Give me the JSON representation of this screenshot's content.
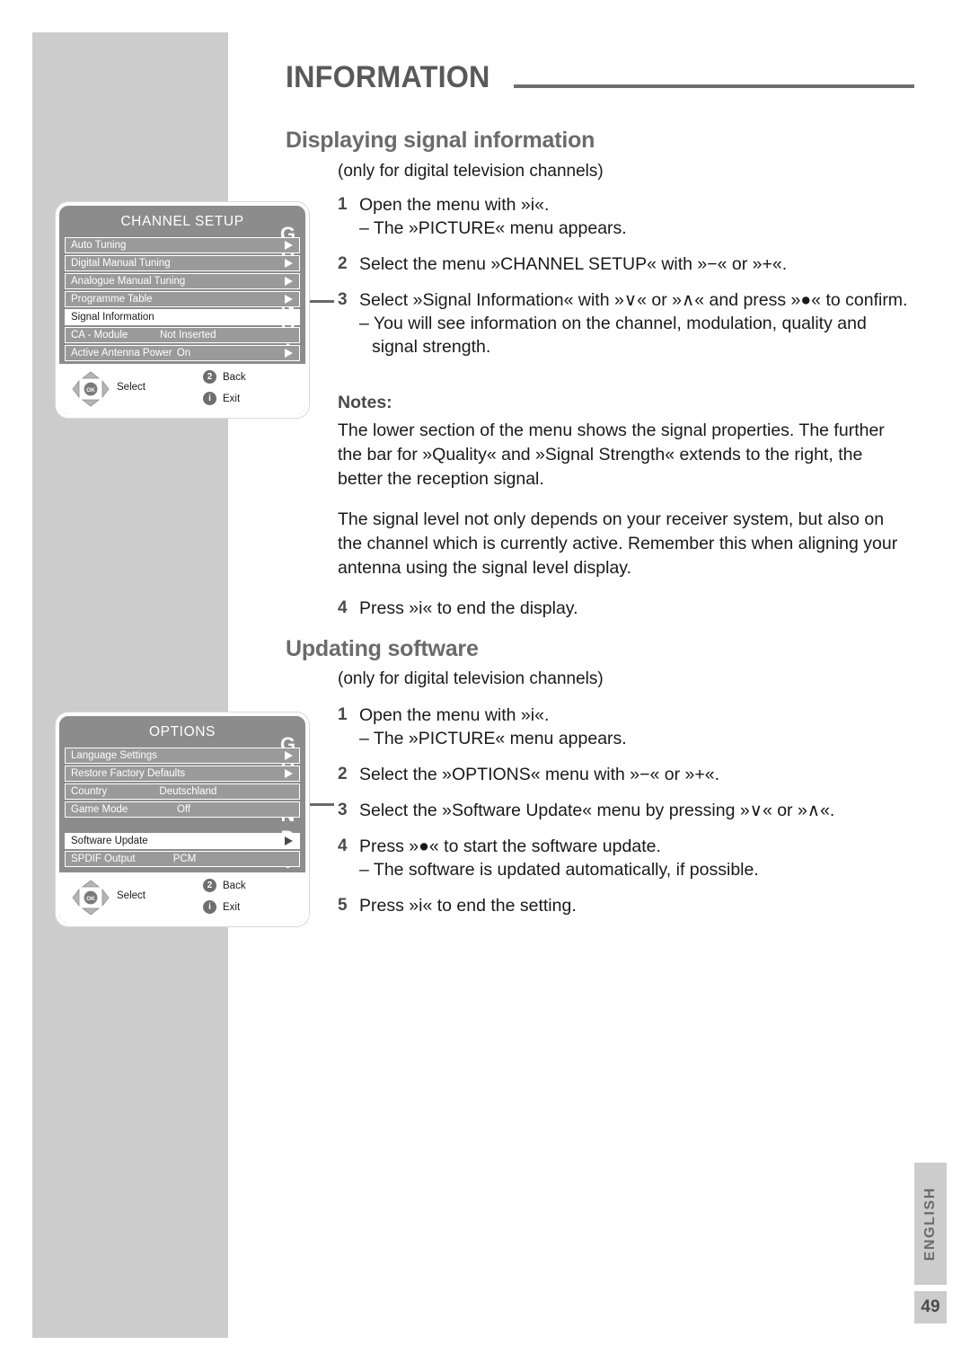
{
  "header": {
    "title": "INFORMATION"
  },
  "sections": [
    {
      "heading": "Displaying signal information",
      "subnote": "(only for digital television channels)"
    },
    {
      "heading": "Updating software",
      "subnote": "(only for digital television channels)"
    }
  ],
  "steps_signal": [
    {
      "num": "1",
      "text": "Open the menu with »i«.",
      "sub": "– The »PICTURE« menu appears."
    },
    {
      "num": "2",
      "text": "Select the menu »CHANNEL SETUP« with »−« or »+«.",
      "sub": ""
    },
    {
      "num": "3",
      "text": "Select »Signal Information« with »∨« or »∧« and press »●« to confirm.",
      "sub": "– You will see information on the channel, modulation, quality and signal strength."
    }
  ],
  "step_signal_last": {
    "num": "4",
    "text": "Press »i« to end the display."
  },
  "notes": {
    "title": "Notes:",
    "paragraphs": [
      "The lower section of the menu shows the signal properties. The further the bar for »Quality« and »Signal Strength« extends to the right, the better the reception signal.",
      "The signal level not only depends on your receiver system, but also on the channel which is currently active. Remember this when aligning your antenna using the signal level display."
    ]
  },
  "steps_software": [
    {
      "num": "1",
      "text": "Open the menu with »i«.",
      "sub": "– The »PICTURE« menu appears."
    },
    {
      "num": "2",
      "text": "Select the »OPTIONS« menu with »−« or »+«.",
      "sub": ""
    },
    {
      "num": "3",
      "text": "Select the »Software Update« menu by pressing »∨« or »∧«.",
      "sub": ""
    },
    {
      "num": "4",
      "text": "Press »●« to start the software update.",
      "sub": "– The software is updated automatically, if possible."
    },
    {
      "num": "5",
      "text": "Press »i« to end the setting.",
      "sub": ""
    }
  ],
  "osd_channel_setup": {
    "title": "CHANNEL SETUP",
    "brand": "GRUNDIG",
    "rows": [
      {
        "label": "Auto Tuning",
        "value": "",
        "arrow": true,
        "selected": false,
        "spacer": false
      },
      {
        "label": "Digital Manual Tuning",
        "value": "",
        "arrow": true,
        "selected": false,
        "spacer": false
      },
      {
        "label": "Analogue Manual Tuning",
        "value": "",
        "arrow": true,
        "selected": false,
        "spacer": false
      },
      {
        "label": "Programme Table",
        "value": "",
        "arrow": true,
        "selected": false,
        "spacer": false
      },
      {
        "label": "Signal Information",
        "value": "",
        "arrow": false,
        "selected": true,
        "spacer": false
      },
      {
        "label": "CA - Module",
        "value": "Not Inserted",
        "arrow": false,
        "selected": false,
        "spacer": false
      },
      {
        "label": "Active Antenna Power",
        "value": "On",
        "arrow": true,
        "selected": false,
        "spacer": false
      }
    ],
    "footer": {
      "select": "Select",
      "back_badge": "2",
      "back_label": "Back",
      "exit_badge": "i",
      "exit_label": "Exit"
    }
  },
  "osd_options": {
    "title": "OPTIONS",
    "brand": "GRUNDIG",
    "rows": [
      {
        "label": "Language Settings",
        "value": "",
        "arrow": true,
        "selected": false,
        "spacer": false
      },
      {
        "label": "Restore Factory Defaults",
        "value": "",
        "arrow": true,
        "selected": false,
        "spacer": false
      },
      {
        "label": "Country",
        "value": "Deutschland",
        "arrow": false,
        "selected": false,
        "spacer": false
      },
      {
        "label": "Game Mode",
        "value": "Off",
        "arrow": false,
        "selected": false,
        "spacer": false
      },
      {
        "label": "",
        "value": "",
        "arrow": false,
        "selected": false,
        "spacer": true
      },
      {
        "label": "Software Update",
        "value": "",
        "arrow": true,
        "selected": true,
        "spacer": false
      },
      {
        "label": "SPDIF Output",
        "value": "PCM",
        "arrow": false,
        "selected": false,
        "spacer": false
      }
    ],
    "footer": {
      "select": "Select",
      "back_badge": "2",
      "back_label": "Back",
      "exit_badge": "i",
      "exit_label": "Exit"
    }
  },
  "side_tabs": {
    "language": "ENGLISH",
    "page_number": "49"
  },
  "colors": {
    "grey_band": "#cccccc",
    "heading_grey": "#6b6b6b",
    "rule_grey": "#6e6e6e",
    "osd_background": "#8c8c8c",
    "osd_row": "#9a9a9a",
    "osd_selected": "#ffffff"
  }
}
